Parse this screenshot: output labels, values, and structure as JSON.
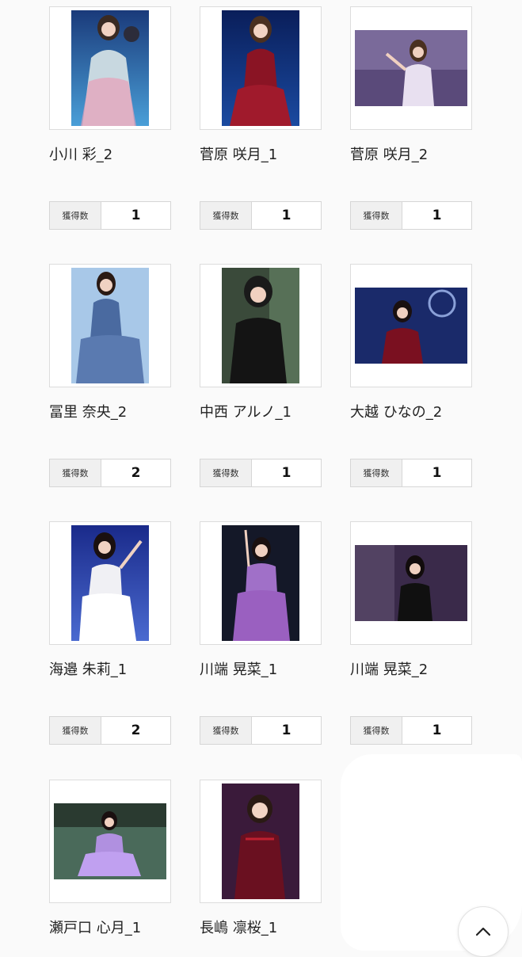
{
  "count_label": "獲得数",
  "colors": {
    "page_bg": "#fafafa",
    "border": "#dcdcdc",
    "label_bg": "#f0f0f0",
    "text": "#222222"
  },
  "scroll_top_icon": "chevron-up-icon",
  "cards": [
    {
      "name": "小川 彩_2",
      "count": "1",
      "photo": "portrait"
    },
    {
      "name": "菅原 咲月_1",
      "count": "1",
      "photo": "portrait"
    },
    {
      "name": "菅原 咲月_2",
      "count": "1",
      "photo": "landscape"
    },
    {
      "name": "冨里 奈央_2",
      "count": "2",
      "photo": "portrait"
    },
    {
      "name": "中西 アルノ_1",
      "count": "1",
      "photo": "portrait"
    },
    {
      "name": "大越 ひなの_2",
      "count": "1",
      "photo": "landscape"
    },
    {
      "name": "海邉 朱莉_1",
      "count": "2",
      "photo": "portrait"
    },
    {
      "name": "川端 晃菜_1",
      "count": "1",
      "photo": "portrait"
    },
    {
      "name": "川端 晃菜_2",
      "count": "1",
      "photo": "landscape"
    },
    {
      "name": "瀬戸口 心月_1",
      "count": "",
      "photo": "landscape"
    },
    {
      "name": "長嶋 凛桜_1",
      "count": "",
      "photo": "portrait"
    }
  ]
}
